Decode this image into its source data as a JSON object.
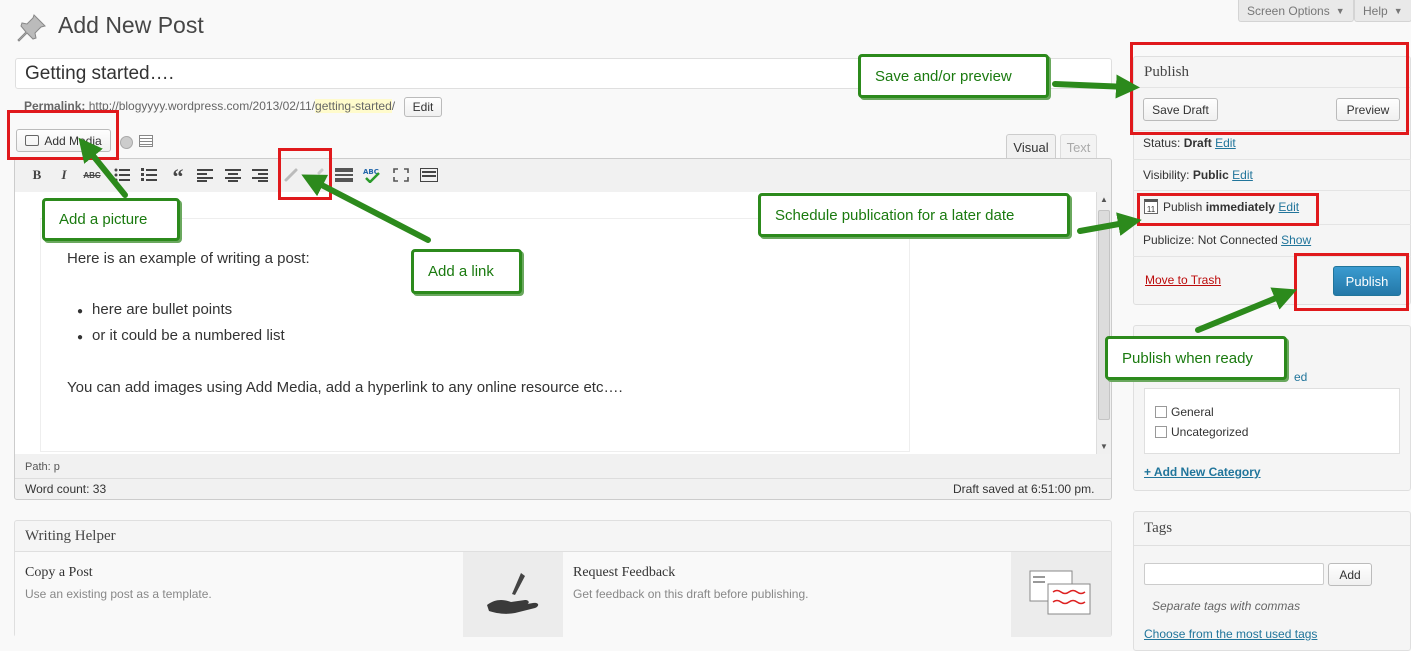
{
  "header": {
    "page_title": "Add New Post",
    "screen_options": "Screen Options",
    "help": "Help"
  },
  "post": {
    "title_value": "Getting started….",
    "permalink_label": "Permalink:",
    "permalink_base": "http://blogyyyy.wordpress.com/2013/02/11/",
    "permalink_slug": "getting-started",
    "permalink_end": "/",
    "edit_button": "Edit"
  },
  "editor": {
    "add_media": "Add Media",
    "tab_visual": "Visual",
    "tab_text": "Text",
    "content_intro": "Here is an example of writing a post:",
    "bullets": [
      "here are bullet points",
      "or it could be a numbered list"
    ],
    "content_outro": "You can add images using Add Media, add a hyperlink to any online resource etc….",
    "path": "Path: p",
    "word_count": "Word count: 33",
    "draft_saved": "Draft saved at 6:51:00 pm."
  },
  "toolbar": {
    "bold": "B",
    "italic": "I",
    "strike": "ABC",
    "quote": "“"
  },
  "writing_helper": {
    "title": "Writing Helper",
    "copy_title": "Copy a Post",
    "copy_desc": "Use an existing post as a template.",
    "feedback_title": "Request Feedback",
    "feedback_desc": "Get feedback on this draft before publishing."
  },
  "publish": {
    "title": "Publish",
    "save_draft": "Save Draft",
    "preview": "Preview",
    "status_label": "Status:",
    "status_value": "Draft",
    "visibility_label": "Visibility:",
    "visibility_value": "Public",
    "publish_label": "Publish",
    "publish_value": "immediately",
    "calendar_num": "11",
    "publicize_label": "Publicize: Not Connected",
    "show": "Show",
    "edit": "Edit",
    "move_to_trash": "Move to Trash",
    "publish_button": "Publish"
  },
  "categories": {
    "partial_tab": "ed",
    "items": [
      "General",
      "Uncategorized"
    ],
    "add_new": "+ Add New Category"
  },
  "tags": {
    "title": "Tags",
    "add_button": "Add",
    "hint": "Separate tags with commas",
    "choose": "Choose from the most used tags"
  },
  "annotations": {
    "save_preview": "Save and/or preview",
    "add_picture": "Add a picture",
    "add_link": "Add a link",
    "schedule": "Schedule publication for a later date",
    "publish_ready": "Publish when ready"
  },
  "colors": {
    "callout_green": "#2c8a1c",
    "highlight_red": "#e0191c",
    "publish_blue": "#2e8bc0",
    "link_blue": "#21759b",
    "trash_red": "#bc0b0b"
  }
}
